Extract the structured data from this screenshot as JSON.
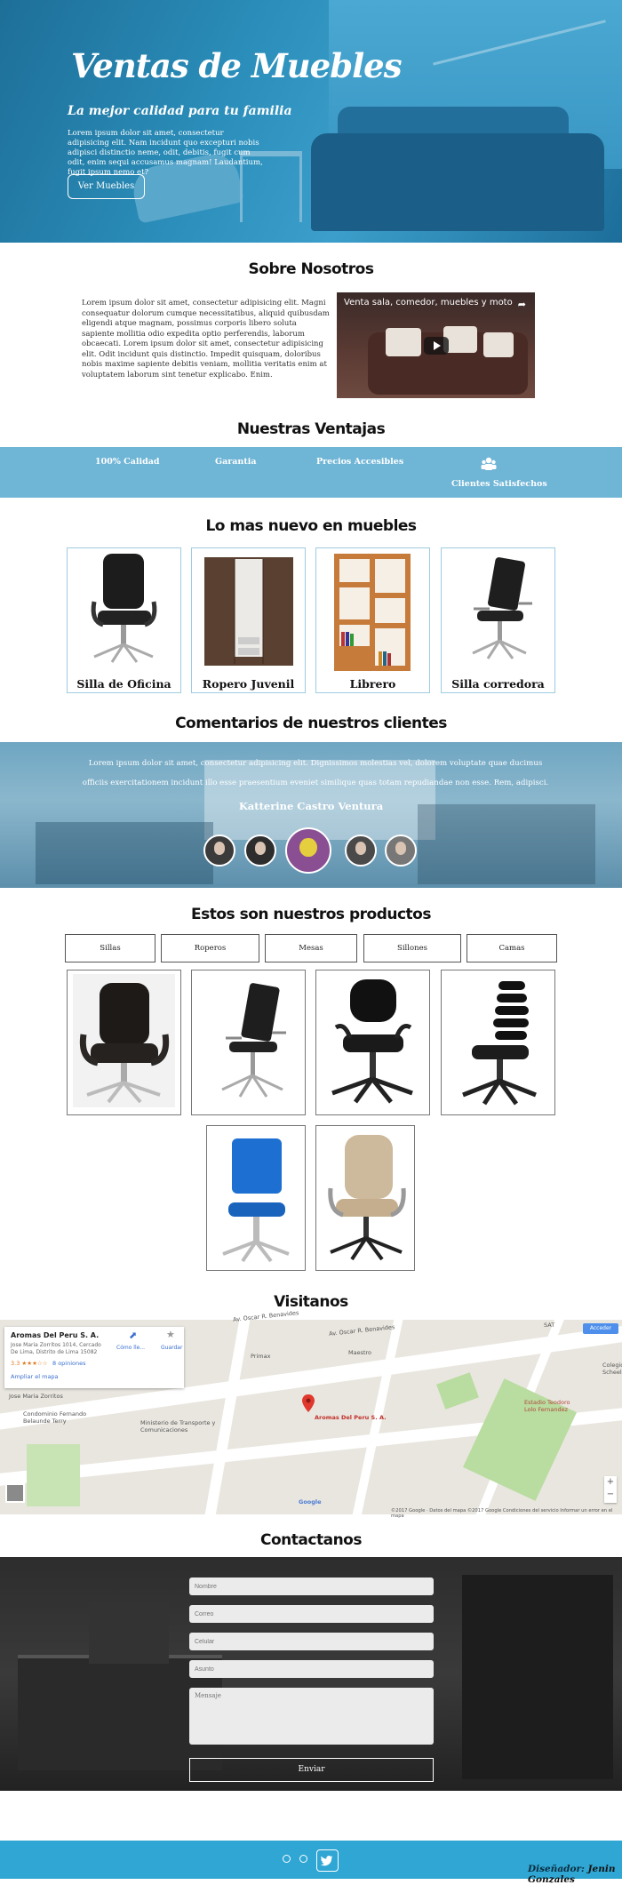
{
  "hero": {
    "title": "Ventas de Muebles",
    "subtitle": "La mejor calidad para tu familia",
    "text": "Lorem ipsum dolor sit amet, consectetur adipisicing elit. Nam incidunt quo excepturi nobis adipisci distinctio neme, odit, debitis, fugit cum odit, enim sequi accusamus magnam! Laudantium, fugit ipsum nemo et?",
    "button": "Ver Muebles"
  },
  "about": {
    "title": "Sobre Nosotros",
    "text": "Lorem ipsum dolor sit amet, consectetur adipisicing elit. Magni consequatur dolorum cumque necessitatibus, aliquid quibusdam eligendi atque magnam, possimus corporis libero soluta sapiente mollitia odio expedita optio perferendis, laborum obcaecati. Lorem ipsum dolor sit amet, consectetur adipisicing elit. Odit incidunt quis distinctio. Impedit quisquam, doloribus nobis maxime sapiente debitis veniam, mollitia veritatis enim at voluptatem laborum sint tenetur explicabo. Enim.",
    "video_title": "Venta sala, comedor, muebles y moto"
  },
  "advantages": {
    "title": "Nuestras Ventajas",
    "items": [
      "100% Calidad",
      "Garantia",
      "Precios Accesibles",
      "Clientes Satisfechos"
    ]
  },
  "latest": {
    "title": "Lo mas nuevo en muebles",
    "items": [
      "Silla de Oficina",
      "Ropero Juvenil",
      "Librero",
      "Silla corredora"
    ]
  },
  "testimonials": {
    "title": "Comentarios de nuestros clientes",
    "text": "Lorem ipsum dolor sit amet, consectetur adipisicing elit. Dignissimos molestias vel, dolorem voluptate quae ducimus officiis exercitationem incidunt illo esse praesentium eveniet similique quas totam repudiandae non esse. Rem, adipisci.",
    "name": "Katterine Castro Ventura"
  },
  "products": {
    "title": "Estos son nuestros productos",
    "tabs": [
      "Sillas",
      "Roperos",
      "Mesas",
      "Sillones",
      "Camas"
    ]
  },
  "visit": {
    "title": "Visitanos",
    "place": "Aromas Del Peru S. A.",
    "address": "Jose Maria Zorritos 1014, Cercado De Lima, Distrito de Lima 15082",
    "rating": "3.3",
    "reviews": "8 opiniones",
    "enlarge": "Ampliar el mapa",
    "directions": "Cómo lle...",
    "save": "Guardar",
    "access": "Acceder",
    "marker_label": "Aromas Del Peru S. A.",
    "labels": [
      "Av. Oscar R. Benavides",
      "Av. Oscar R. Benavides",
      "Primax",
      "Maestro",
      "Jose Maria Zorritos",
      "Ministerio de Transporte y Comunicaciones",
      "Estadio Teodoro Lolo Fernandez",
      "Condominio Fernando Belaunde Terry",
      "SAT",
      "Colegio Scheel",
      "Google"
    ],
    "footer_note": "©2017 Google · Datos del mapa ©2017 Google  Condiciones del servicio  Informar un error en el mapa"
  },
  "contact": {
    "title": "Contactanos",
    "fields": [
      "Nombre",
      "Correo",
      "Celular",
      "Asunto",
      "Mensaje"
    ],
    "button": "Enviar"
  },
  "footer": {
    "credit_label": "Diseñador:",
    "credit_name": "Jenin Gonzales"
  }
}
